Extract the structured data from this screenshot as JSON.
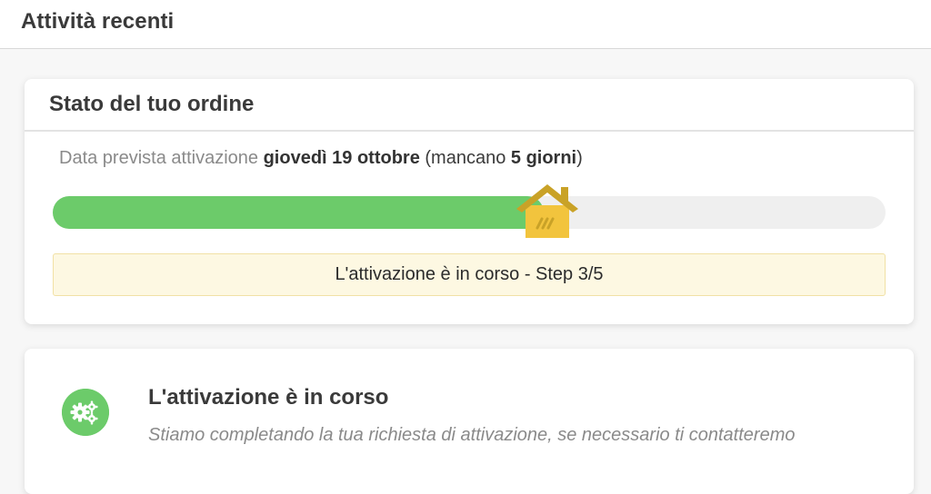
{
  "header": {
    "title": "Attività recenti"
  },
  "order_status": {
    "title": "Stato del tuo ordine",
    "activation_label": "Data prevista attivazione",
    "activation_date": "giovedì 19 ottobre",
    "remaining_open": "(mancano",
    "remaining_days": "5 giorni",
    "remaining_close": ")",
    "progress_fraction": 0.59,
    "step_text": "L'attivazione è in corso - Step 3/5",
    "colors": {
      "progress_fill": "#6ccb6a",
      "progress_track": "#efefef",
      "house": "#f2c43d",
      "house_roof": "#c9a227",
      "step_box_bg": "#fdf8e2"
    }
  },
  "activity": {
    "icon": "gears-icon",
    "title": "L'attivazione è in corso",
    "description": "Stiamo completando la tua richiesta di attivazione, se necessario ti contatteremo"
  }
}
